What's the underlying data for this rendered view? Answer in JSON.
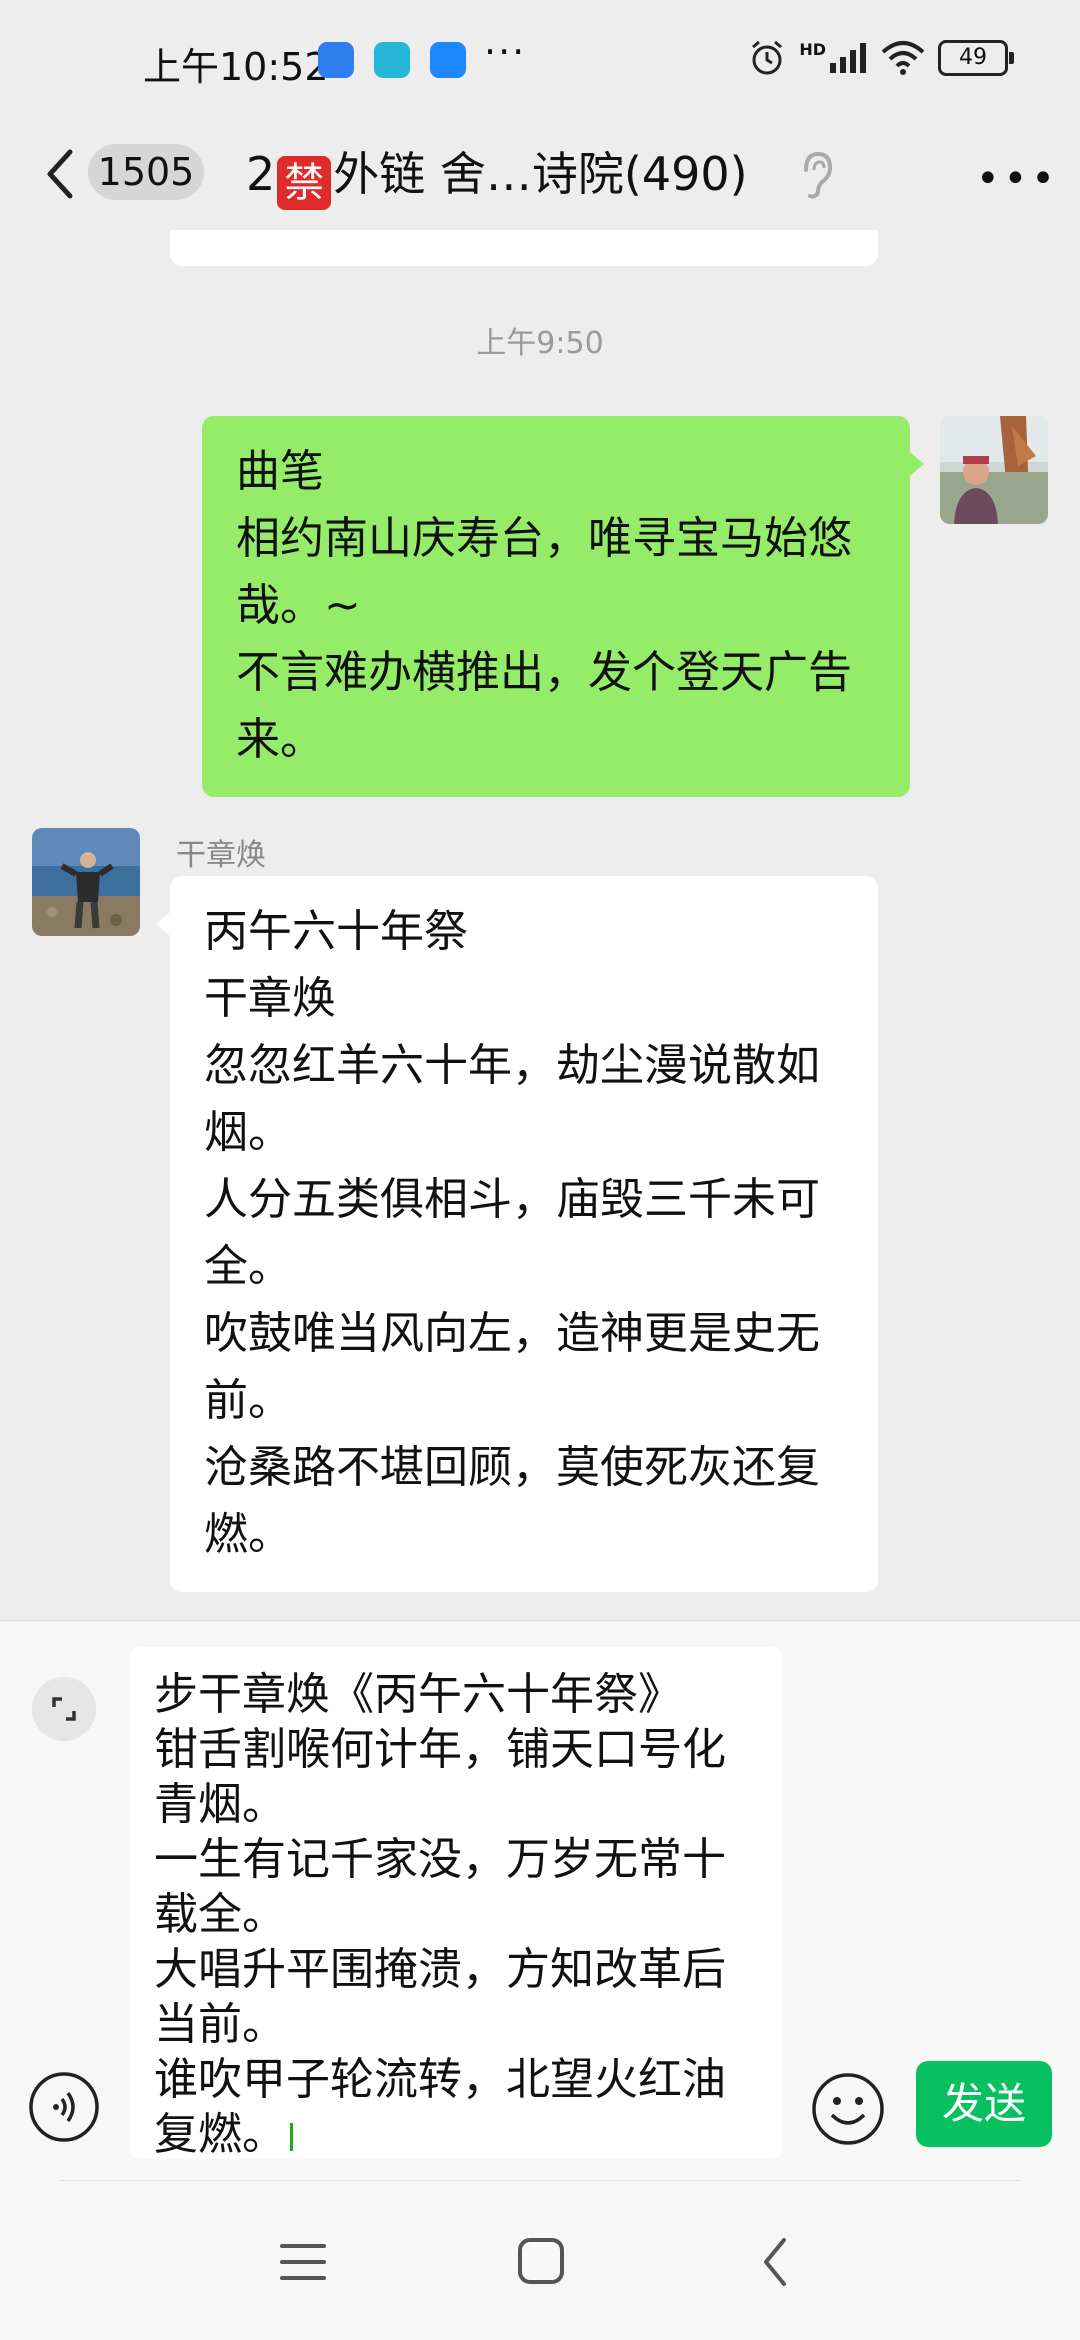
{
  "status_bar": {
    "time": "上午10:52",
    "dots": "···",
    "network_label": "HD",
    "battery": "49"
  },
  "header": {
    "back_badge": "1505",
    "title_prefix": "2",
    "banned_char": "禁",
    "title_suffix": "外链 舍…诗院(490)"
  },
  "chat": {
    "timestamp": "上午9:50",
    "messages": [
      {
        "side": "me",
        "lines": [
          "曲笔",
          "相约南山庆寿台，唯寻宝马始悠",
          "哉。~",
          "不言难办横推出，发个登天广告",
          "来。"
        ]
      },
      {
        "side": "other",
        "sender": "干章焕",
        "lines": [
          "丙午六十年祭",
          "干章焕",
          "忽忽红羊六十年，劫尘漫说散如",
          "烟。",
          "人分五类俱相斗，庙毁三千未可",
          "全。",
          "吹鼓唯当风向左，造神更是史无",
          "前。",
          "沧桑路不堪回顾，莫使死灰还复",
          "燃。"
        ]
      }
    ]
  },
  "input": {
    "lines": [
      "步干章焕《丙午六十年祭》",
      "钳舌割喉何计年，铺天口号化",
      "青烟。",
      "一生有记千家没，万岁无常十",
      "载全。",
      "大唱升平围掩溃，方知改革后",
      "当前。",
      "谁吹甲子轮流转，北望火红油",
      "复燃。"
    ],
    "send_label": "发送"
  },
  "icons": {
    "back": "chevron-left-icon",
    "ear": "ear-icon",
    "more": "more-icon",
    "expand": "expand-icon",
    "voice": "voice-icon",
    "emoji": "emoji-icon"
  },
  "colors": {
    "my_bubble": "#95ec69",
    "send_button": "#07c160",
    "ban_badge": "#e02b2b"
  }
}
